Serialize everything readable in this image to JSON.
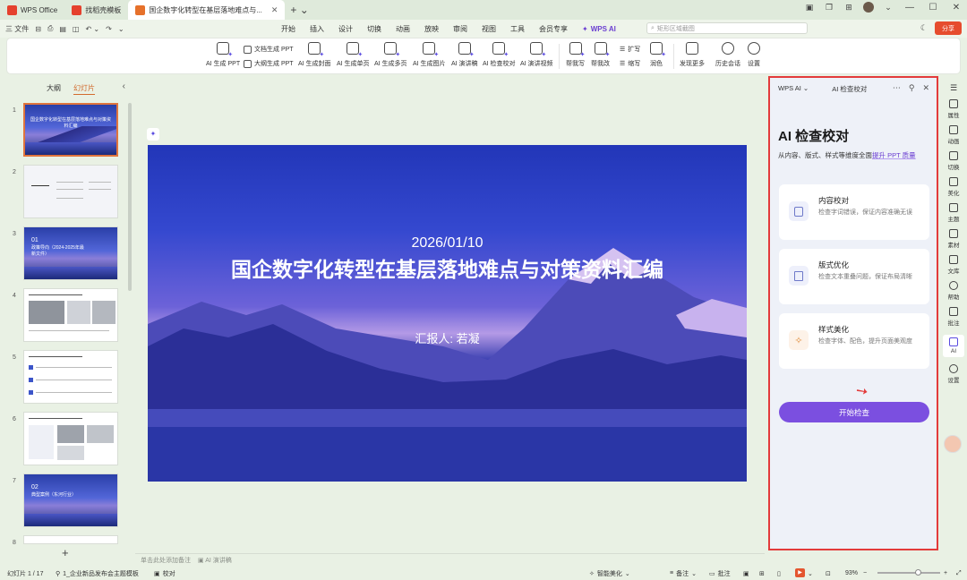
{
  "tabs": [
    {
      "label": "WPS Office",
      "logo_color": "#e5412d"
    },
    {
      "label": "找稻壳模板",
      "logo_color": "#e5412d"
    },
    {
      "label": "国企数字化转型在基层落地难点与...",
      "logo_color": "#e6712b"
    }
  ],
  "menu": {
    "file_label": "三 文件",
    "items": [
      "开始",
      "插入",
      "设计",
      "切换",
      "动画",
      "放映",
      "审阅",
      "视图",
      "工具",
      "会员专享"
    ],
    "wps_ai_label": "WPS AI",
    "search_placeholder": "矩形区域截图",
    "share_label": "分享"
  },
  "ribbon": {
    "ai_ppt": "AI 生成 PPT",
    "doc_ppt": "文档生成 PPT",
    "outline_ppt": "大纲生成 PPT",
    "ai_cover": "AI 生成封面",
    "ai_single": "AI 生成单页",
    "ai_multi": "AI 生成多页",
    "ai_image": "AI 生成图片",
    "ai_speech": "AI 演讲稿",
    "ai_check": "AI 检查校对",
    "ai_video": "AI 演讲视频",
    "help_write": "帮我写",
    "help_edit": "帮我改",
    "expand": "扩写",
    "shrink": "缩写",
    "polish": "润色",
    "discover": "发现更多",
    "history": "历史会话",
    "settings": "设置"
  },
  "left_panel": {
    "tab_outline": "大纲",
    "tab_slides": "幻灯片",
    "slide_numbers": [
      "1",
      "2",
      "3",
      "4",
      "5",
      "6",
      "7",
      "8"
    ],
    "thumb1_title": "国企数字化转型在基层落地难点与对策资料汇编",
    "thumb3_num": "01",
    "thumb3_title": "政策导向（2024-2025年最新文件）",
    "thumb7_num": "02",
    "thumb7_title": "典型案例（东河行业）"
  },
  "slide": {
    "date": "2026/01/10",
    "title": "国企数字化转型在基层落地难点与对策资料汇编",
    "reporter": "汇报人: 若凝"
  },
  "notes_placeholder": "单击此处添加备注",
  "notes_ai": "AI 演讲稿",
  "ai_panel": {
    "brand": "WPS AI ⌄",
    "title_tab": "AI 检查校对",
    "heading": "AI 检查校对",
    "subtitle_prefix": "从内容、版式、样式等维度全面",
    "subtitle_highlight": "提升 PPT 质量",
    "cards": [
      {
        "title": "内容校对",
        "desc": "检查字词错误，保证内容准确无误"
      },
      {
        "title": "版式优化",
        "desc": "检查文本重叠问题，保证布局清晰"
      },
      {
        "title": "样式美化",
        "desc": "检查字体、配色，提升页面美观度"
      }
    ],
    "start_button": "开始检查"
  },
  "right_bar": [
    "属性",
    "动画",
    "切换",
    "美化",
    "主题",
    "素材",
    "文库",
    "帮助",
    "批注",
    "AI",
    "设置"
  ],
  "status": {
    "slide_count": "幻灯片 1 / 17",
    "template": "1_企业新品发布会主题模板",
    "proofread": "校对",
    "smart_beautify": "智能美化",
    "notes": "备注",
    "comments": "批注",
    "zoom": "93%"
  }
}
